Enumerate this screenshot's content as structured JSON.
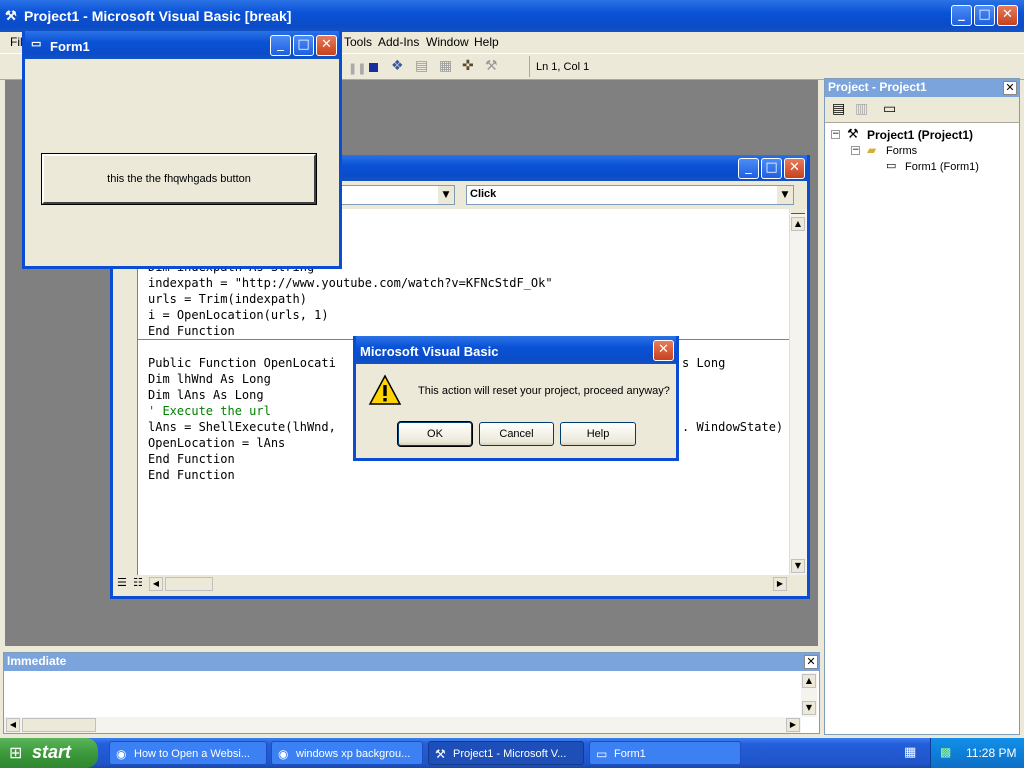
{
  "ide": {
    "title": "Project1 - Microsoft Visual Basic [break]",
    "menu": [
      "File",
      "Tools",
      "Add-Ins",
      "Window",
      "Help"
    ],
    "position": "Ln 1, Col 1"
  },
  "form1": {
    "title": "Form1",
    "button_label": "this the the fhqwhgads button"
  },
  "code_window": {
    "procedure": "Click",
    "lines_top": [
      "Dim indexpath As String",
      "indexpath = \"http://www.youtube.com/watch?v=KFNcStdF_Ok\"",
      "urls = Trim(indexpath)",
      "i = OpenLocation(urls, 1)",
      "End Function"
    ],
    "lines_bottom": [
      "Public Function OpenLocati",
      "Dim lhWnd As Long",
      "Dim lAns As Long",
      "' Execute the url",
      "lAns = ShellExecute(lhWnd,",
      "OpenLocation = lAns",
      "End Function",
      "End Function"
    ],
    "right_fragments": {
      "line1": "s Long",
      "line5": ". WindowState)"
    }
  },
  "dialog": {
    "title": "Microsoft Visual Basic",
    "message": "This action will reset your project, proceed anyway?",
    "ok": "OK",
    "cancel": "Cancel",
    "help": "Help"
  },
  "project_explorer": {
    "title": "Project - Project1",
    "root": "Project1 (Project1)",
    "folder": "Forms",
    "item": "Form1 (Form1)"
  },
  "immediate": {
    "title": "Immediate"
  },
  "taskbar": {
    "start": "start",
    "tasks": [
      "How to Open a Websi...",
      "windows xp backgrou...",
      "Project1 - Microsoft V...",
      "Form1"
    ],
    "clock": "11:28 PM"
  },
  "colors": {
    "xp_blue": "#0a52d6",
    "start_green": "#3c9a3c",
    "comment_green": "#008000",
    "workspace_gray": "#808080"
  }
}
